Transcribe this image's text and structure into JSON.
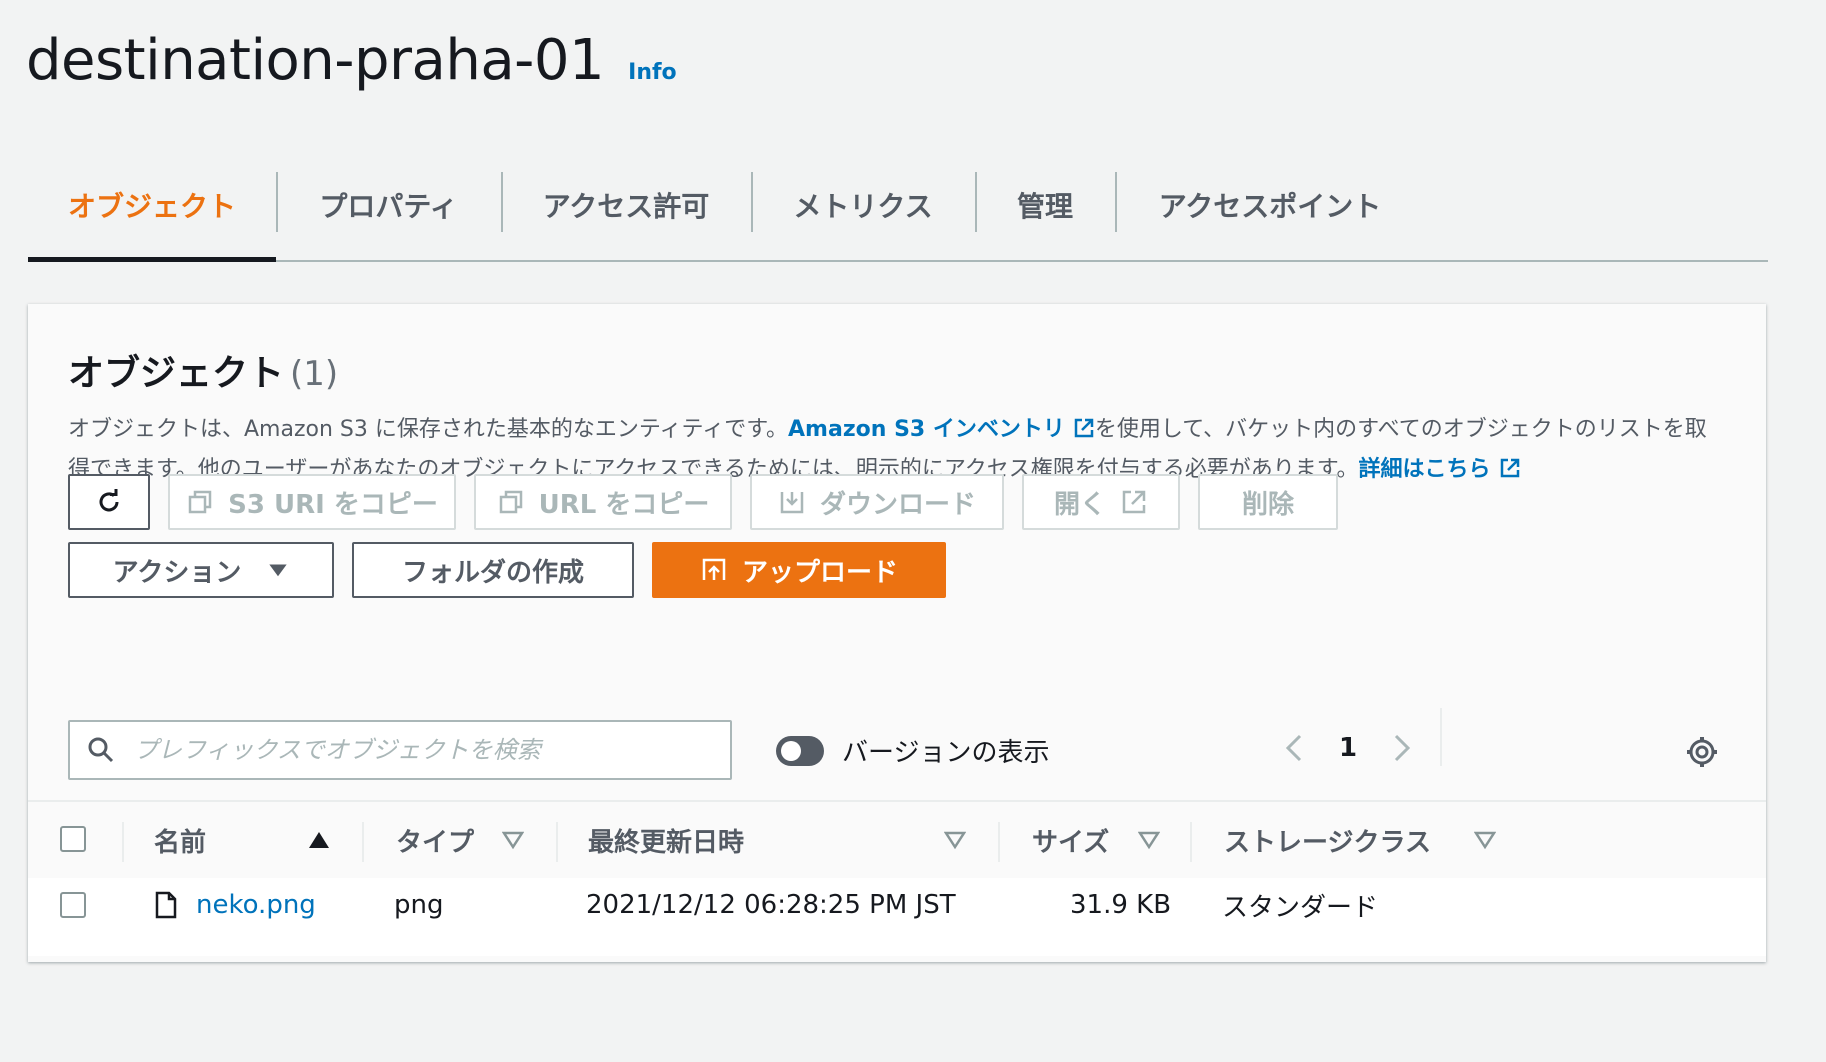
{
  "header": {
    "title": "destination-praha-01",
    "info_link": "Info"
  },
  "tabs": [
    {
      "label": "オブジェクト",
      "active": true
    },
    {
      "label": "プロパティ",
      "active": false
    },
    {
      "label": "アクセス許可",
      "active": false
    },
    {
      "label": "メトリクス",
      "active": false
    },
    {
      "label": "管理",
      "active": false
    },
    {
      "label": "アクセスポイント",
      "active": false
    }
  ],
  "panel": {
    "title": "オブジェクト",
    "count": "(1)",
    "description": {
      "part1": "オブジェクトは、Amazon S3 に保存された基本的なエンティティです。",
      "link1": "Amazon S3 インベントリ",
      "part2": "を使用して、バケット内のすべてのオブジェクトのリストを取得できます。他のユーザーがあなたのオブジェクトにアクセスできるためには、明示的にアクセス権限を付与する必要があります。",
      "link2": "詳細はこちら"
    }
  },
  "toolbar": {
    "copy_s3_uri": "S3 URI をコピー",
    "copy_url": "URL をコピー",
    "download": "ダウンロード",
    "open": "開く",
    "delete": "削除",
    "actions": "アクション",
    "create_folder": "フォルダの作成",
    "upload": "アップロード"
  },
  "search": {
    "placeholder": "プレフィックスでオブジェクトを検索",
    "value": ""
  },
  "versions_toggle": {
    "label": "バージョンの表示",
    "on": false
  },
  "pagination": {
    "current_page": "1"
  },
  "table": {
    "columns": [
      "名前",
      "タイプ",
      "最終更新日時",
      "サイズ",
      "ストレージクラス"
    ],
    "rows": [
      {
        "name": "neko.png",
        "type": "png",
        "last_modified": "2021/12/12 06:28:25 PM JST",
        "size": "31.9 KB",
        "storage_class": "スタンダード"
      }
    ]
  },
  "colors": {
    "accent": "#ec7211",
    "link": "#0073bb",
    "text": "#16191f",
    "muted": "#545b64",
    "background": "#f2f3f3"
  }
}
